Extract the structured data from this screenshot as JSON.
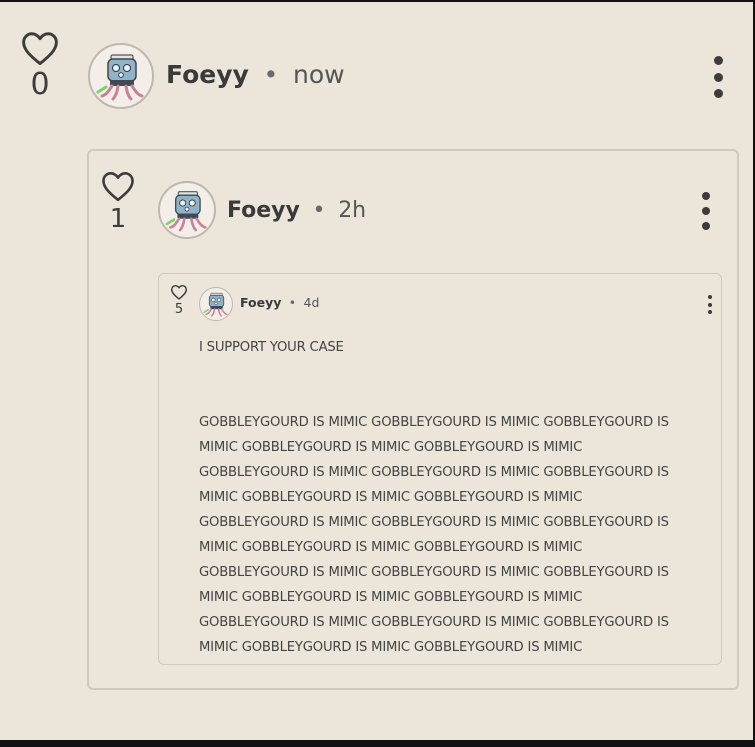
{
  "colors": {
    "background": "#ece5da",
    "border": "#d0c9bf",
    "text": "#3a3a3a",
    "frame": "#111111"
  },
  "comments": [
    {
      "likes": "0",
      "username": "Foeyy",
      "separator": "•",
      "time": "now",
      "avatar_icon": "robot-creature-avatar"
    },
    {
      "likes": "1",
      "username": "Foeyy",
      "separator": "•",
      "time": "2h",
      "avatar_icon": "robot-creature-avatar"
    },
    {
      "likes": "5",
      "username": "Foeyy",
      "separator": "•",
      "time": "4d",
      "avatar_icon": "robot-creature-avatar",
      "body_first": "I SUPPORT YOUR CASE",
      "body_lines": [
        "GOBBLEYGOURD IS MIMIC GOBBLEYGOURD IS MIMIC GOBBLEYGOURD IS",
        "MIMIC GOBBLEYGOURD IS MIMIC GOBBLEYGOURD IS MIMIC",
        "GOBBLEYGOURD IS MIMIC GOBBLEYGOURD IS MIMIC GOBBLEYGOURD IS",
        "MIMIC GOBBLEYGOURD IS MIMIC GOBBLEYGOURD IS MIMIC",
        "GOBBLEYGOURD IS MIMIC GOBBLEYGOURD IS MIMIC GOBBLEYGOURD IS",
        "MIMIC GOBBLEYGOURD IS MIMIC GOBBLEYGOURD IS MIMIC",
        "GOBBLEYGOURD IS MIMIC GOBBLEYGOURD IS MIMIC GOBBLEYGOURD IS",
        "MIMIC GOBBLEYGOURD IS MIMIC GOBBLEYGOURD IS MIMIC",
        "GOBBLEYGOURD IS MIMIC GOBBLEYGOURD IS MIMIC GOBBLEYGOURD IS",
        "MIMIC GOBBLEYGOURD IS MIMIC GOBBLEYGOURD IS MIMIC"
      ]
    }
  ]
}
